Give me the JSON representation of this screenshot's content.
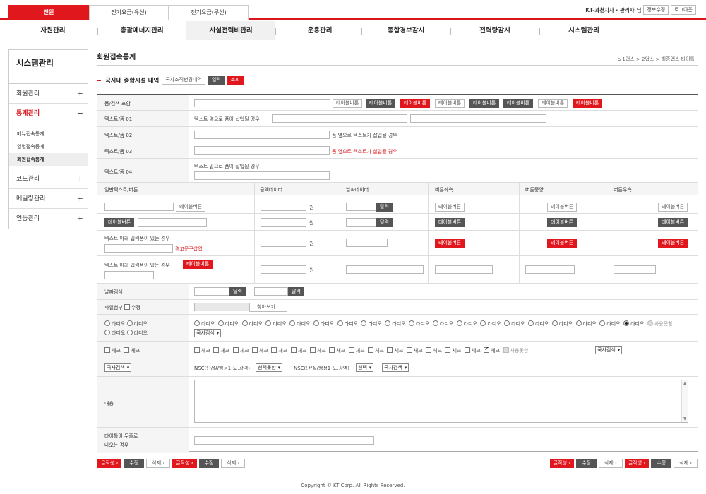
{
  "top_tabs": [
    "전원",
    "전기요금(유선)",
    "전기요금(무선)"
  ],
  "user": {
    "name": "KT-과천지사 · 관리자",
    "suffix": "님",
    "info_btn": "정보수정",
    "logout_btn": "로그아웃"
  },
  "gnav": [
    "자원관리",
    "총괄에너지관리",
    "시설전력비관리",
    "운용관리",
    "종합경보감시",
    "전력량감시",
    "시스템관리"
  ],
  "side": {
    "title": "시스템관리",
    "menus": [
      "회원관리",
      "통계관리",
      "코드관리",
      "메일링관리",
      "연동관리"
    ],
    "sub": [
      "메뉴접속통계",
      "일별접속통계",
      "회원접속통계"
    ],
    "plus": "+",
    "minus": "−"
  },
  "page": {
    "title": "회원접속통계",
    "breadcrumb": "1업스 > 2업스 > 최종엡스 타이틀"
  },
  "section": {
    "title": "국사내 종합시설 내역",
    "btn1": "국사조직변경내역",
    "btn2": "입력",
    "btn3": "조회"
  },
  "labels": {
    "r1": "폼/검색 포함",
    "r2": "텍스트/폼 01",
    "r3": "텍스트/폼 02",
    "r4": "텍스트/폼 03",
    "r5": "텍스트/폼 04",
    "date": "날짜검색",
    "file": "파일첨부",
    "content": "내용",
    "title2": "타이틀이 두줄로",
    "title2b": "나오는 경우"
  },
  "btns": {
    "table": "테이블버튼",
    "cal": "달력",
    "find": "찾아보기...",
    "write": "글작성 ›",
    "edit": "수정",
    "del": "삭제 ›"
  },
  "texts": {
    "t1": "텍스트 옆으로 폼이 삽입될 경우",
    "t2": "폼 옆으로 텍스트가 삽입될 경우",
    "t3": "폼 옆으로 텍스트가 삽입될 경우",
    "t4": "텍스트 밑으로 폼이 삽입될 경우",
    "below1": "텍스트 아래 입력폼이 있는 경우",
    "warn": "경고문구삽입",
    "below2": "텍스트 아래 입력폼이 있는 경우",
    "won": "원",
    "tilde": "~",
    "edit_chk": "수정",
    "nsc": "NSC(단/실/행정1-도,광역)",
    "sel_all": "선택못함",
    "sel": "선택",
    "sel_kuksa": "국사검색",
    "radio": "라디오",
    "radio_dis": "사용못함",
    "check": "체크",
    "check_dis": "사용못함"
  },
  "cols": [
    "일반텍스트/버튼",
    "금액데이터",
    "날짜데이터",
    "버튼좌측",
    "버튼중앙",
    "버튼우측"
  ],
  "footer": "Copyright © KT Corp. All Rights Reserved."
}
